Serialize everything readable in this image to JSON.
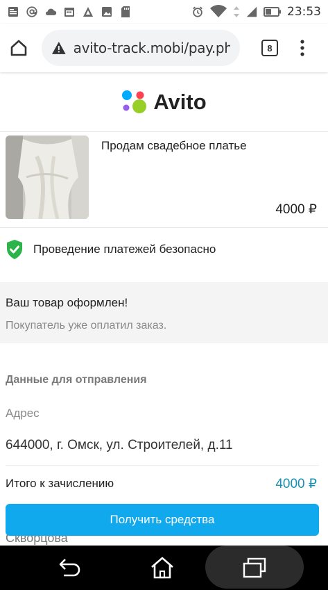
{
  "status_bar": {
    "time": "23:53",
    "left_icons": [
      "news-icon",
      "at-sign-icon",
      "cloud-icon",
      "calendar-icon",
      "delta-icon",
      "image-icon",
      "sd-card-icon"
    ],
    "right_icons": [
      "alarm-icon",
      "wifi-icon",
      "data-arrows-icon",
      "signal-icon",
      "battery-icon"
    ]
  },
  "browser": {
    "url": "avito-track.mobi/pay.ph",
    "tab_count": "8"
  },
  "header": {
    "brand": "Avito",
    "logo_colors": [
      "#00aaff",
      "#ff4053",
      "#965eeb",
      "#97cf26"
    ]
  },
  "product": {
    "title": "Продам свадебное платье",
    "price": "4000 ₽"
  },
  "secure": {
    "text": "Проведение платежей безопасно",
    "shield_color": "#2cb34a"
  },
  "notice": {
    "title": "Ваш товар оформлен!",
    "subtitle": "Покупатель уже оплатил заказ."
  },
  "shipping": {
    "heading": "Данные для отправления",
    "address_label": "Адрес",
    "address_value": "644000, г. Омск, ул. Строителей, д.11",
    "partial_name": "Скворцова"
  },
  "summary": {
    "total_label": "Итого к зачислению",
    "total_value": "4000 ₽",
    "accent_color": "#1a8fb0"
  },
  "cta": {
    "label": "Получить средства",
    "color": "#11a9ee"
  },
  "nav": {
    "buttons": [
      "back-icon",
      "home-icon",
      "recent-apps-icon"
    ]
  }
}
